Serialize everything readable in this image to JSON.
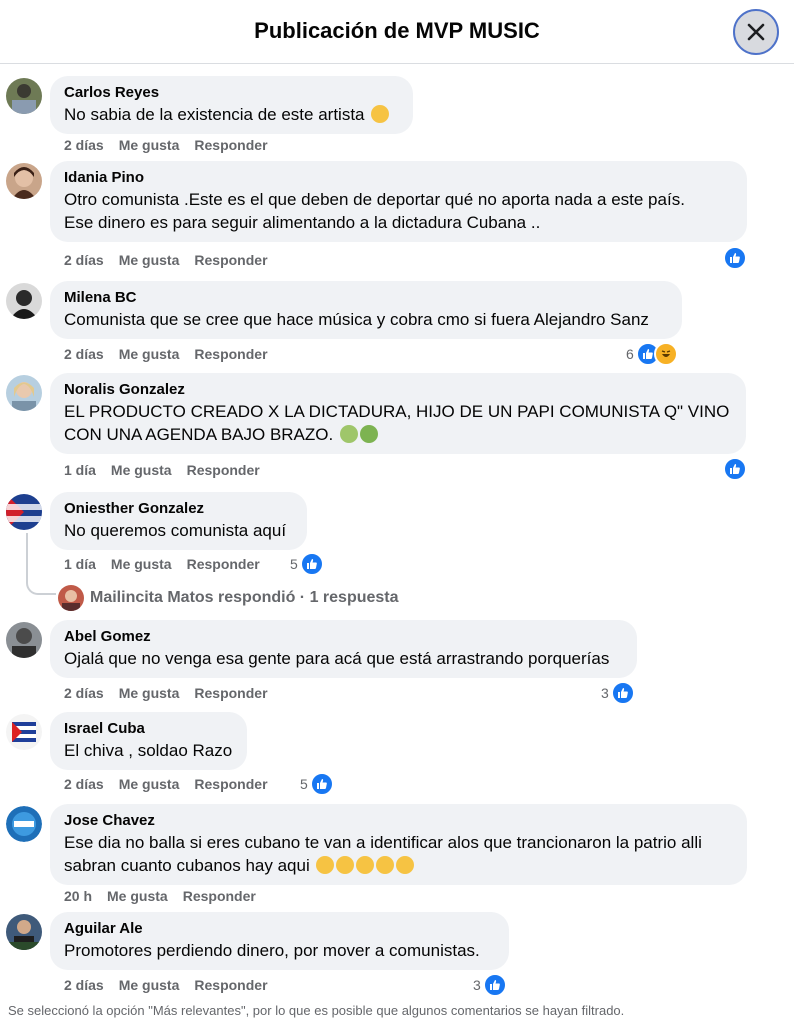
{
  "header": {
    "title": "Publicación de MVP MUSIC"
  },
  "action_labels": {
    "like": "Me gusta",
    "reply": "Responder"
  },
  "comments": [
    {
      "author": "Carlos Reyes",
      "lines": [
        "No sabia de la existencia de este artista"
      ],
      "time": "2 días",
      "reaction_count": ""
    },
    {
      "author": "Idania Pino",
      "lines": [
        "Otro comunista .Este es el que deben de deportar qué no aporta nada a este país.",
        "Ese dinero es para seguir alimentando a la dictadura Cubana .."
      ],
      "time": "2 días",
      "reaction_count": ""
    },
    {
      "author": "Milena BC",
      "lines": [
        "Comunista que se cree que hace música y cobra cmo si fuera Alejandro Sanz"
      ],
      "time": "2 días",
      "reaction_count": "6"
    },
    {
      "author": "Noralis Gonzalez",
      "lines": [
        "EL PRODUCTO CREADO X LA DICTADURA, HIJO DE UN PAPI COMUNISTA Q\" VINO",
        "CON UNA AGENDA BAJO BRAZO."
      ],
      "time": "1 día",
      "reaction_count": ""
    },
    {
      "author": "Oniesther Gonzalez",
      "lines": [
        "No queremos comunista aquí"
      ],
      "time": "1 día",
      "reaction_count": "5"
    },
    {
      "author": "Abel Gomez",
      "lines": [
        "Ojalá que no venga esa gente para acá que está arrastrando porquerías"
      ],
      "time": "2 días",
      "reaction_count": "3"
    },
    {
      "author": "Israel Cuba",
      "lines": [
        "El chiva , soldao Razo"
      ],
      "time": "2 días",
      "reaction_count": "5"
    },
    {
      "author": "Jose Chavez",
      "lines": [
        "Ese dia no balla si eres cubano te van a identificar alos que trancionaron la patrio alli",
        "sabran cuanto cubanos hay aqui"
      ],
      "time": "20 h",
      "reaction_count": ""
    },
    {
      "author": "Aguilar Ale",
      "lines": [
        "Promotores perdiendo dinero, por mover a comunistas."
      ],
      "time": "2 días",
      "reaction_count": "3"
    }
  ],
  "reply_thread": {
    "text": "Mailincita Matos respondió · 1 respuesta"
  },
  "footer": {
    "note": "Se seleccionó la opción \"Más relevantes\", por lo que es posible que algunos comentarios se hayan filtrado."
  },
  "colors": {
    "bubble": "#f0f2f5",
    "like_blue": "#1877f2",
    "muted": "#65676b"
  },
  "icons": {
    "close": "close-icon",
    "like": "like-icon",
    "haha": "haha-icon"
  }
}
